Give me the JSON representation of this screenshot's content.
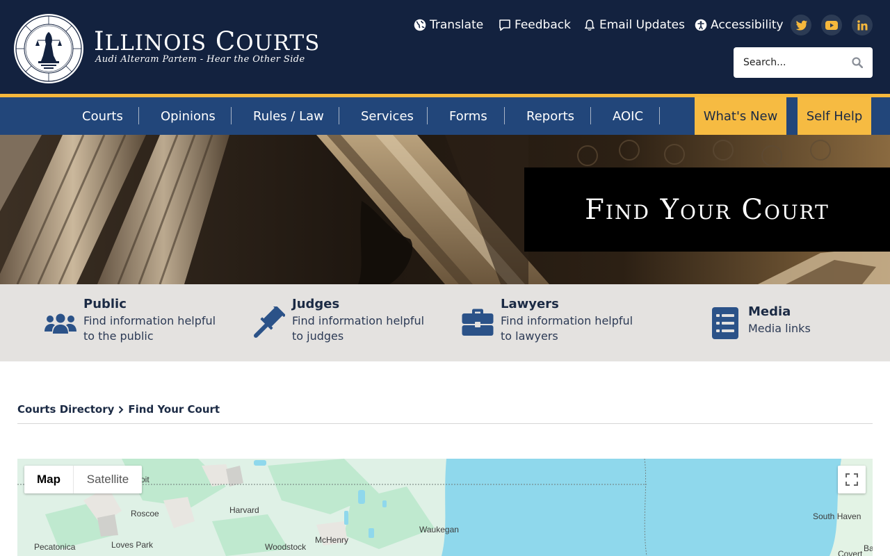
{
  "header": {
    "title_big_1": "I",
    "title_small_1": "LLINOIS",
    "title_big_2": "C",
    "title_small_2": "OURTS",
    "tagline": "Audi Alteram Partem - Hear the Other Side",
    "seal_text": "SEAL OF THE SUPREME COURT · STATE OF ILLINOIS · AUG. 26, 1818",
    "utilities": {
      "translate": "Translate",
      "feedback": "Feedback",
      "email_updates": "Email Updates",
      "accessibility": "Accessibility"
    },
    "social": [
      "twitter-icon",
      "youtube-icon",
      "linkedin-icon"
    ],
    "search": {
      "placeholder": "Search..."
    }
  },
  "nav": {
    "items": [
      "Courts",
      "Opinions",
      "Rules / Law",
      "Services",
      "Forms",
      "Reports",
      "AOIC"
    ],
    "whats_new": "What's New",
    "self_help": "Self Help"
  },
  "hero": {
    "title": "Find Your Court"
  },
  "audiences": [
    {
      "title": "Public",
      "description": "Find information helpful to the public",
      "icon": "users-icon"
    },
    {
      "title": "Judges",
      "description": "Find information helpful to judges",
      "icon": "gavel-icon"
    },
    {
      "title": "Lawyers",
      "description": "Find information helpful to lawyers",
      "icon": "briefcase-icon"
    },
    {
      "title": "Media",
      "description": "Media links",
      "icon": "list-icon"
    }
  ],
  "breadcrumb": {
    "parent": "Courts Directory",
    "current": "Find Your Court"
  },
  "map": {
    "type_map": "Map",
    "type_satellite": "Satellite",
    "places": [
      "Roscoe",
      "Harvard",
      "Pecatonica",
      "Loves Park",
      "Woodstock",
      "McHenry",
      "Waukegan",
      "South Haven",
      "Covert",
      "Ba",
      "oit"
    ]
  },
  "colors": {
    "header_bg": "#13223f",
    "nav_bg": "#22467a",
    "accent_gold": "#f6bb42",
    "audience_bg": "#e4e2e0",
    "icon_blue": "#2b5288",
    "lake_blue": "#8fd8ec"
  }
}
